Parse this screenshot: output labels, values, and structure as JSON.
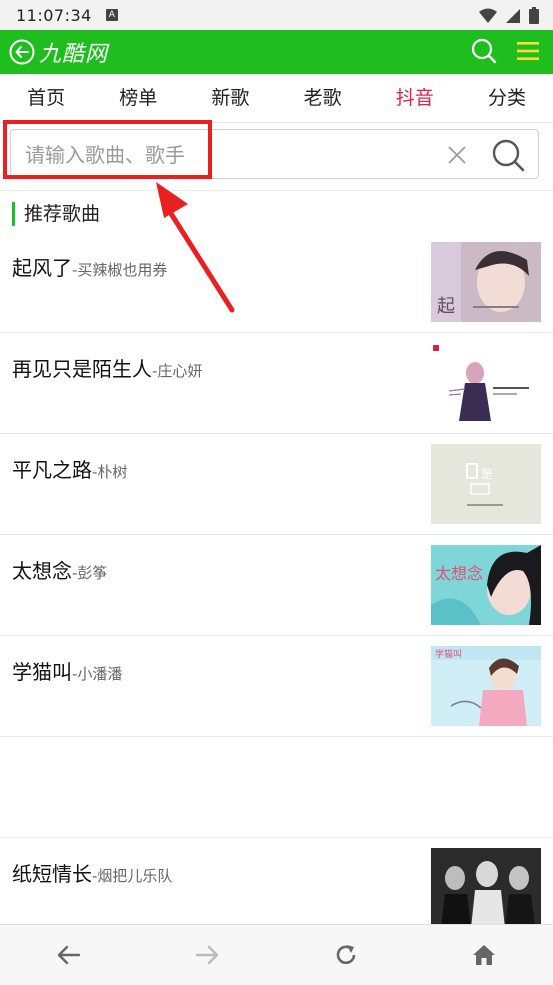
{
  "status_bar": {
    "time": "11:07:34",
    "badge": "A",
    "icons": [
      "wifi-icon",
      "signal-icon",
      "battery-icon"
    ]
  },
  "app_bar": {
    "title": "九酷网",
    "icons": [
      "back-icon",
      "search-icon",
      "menu-icon"
    ],
    "background": "#1fbe1f",
    "menu_color": "#ffdd33"
  },
  "nav": {
    "tabs": [
      {
        "label": "首页"
      },
      {
        "label": "榜单"
      },
      {
        "label": "新歌"
      },
      {
        "label": "老歌"
      },
      {
        "label": "抖音",
        "active": true
      },
      {
        "label": "分类"
      }
    ],
    "active_color": "#e8204a"
  },
  "search": {
    "placeholder": "请输入歌曲、歌手",
    "value": ""
  },
  "section": {
    "title": "推荐歌曲"
  },
  "songs": [
    {
      "title": "起风了",
      "artist": "-买辣椒也用券"
    },
    {
      "title": "再见只是陌生人",
      "artist": "-庄心妍"
    },
    {
      "title": "平凡之路",
      "artist": "-朴树"
    },
    {
      "title": "太想念",
      "artist": "-彭筝"
    },
    {
      "title": "学猫叫",
      "artist": "-小潘潘"
    },
    {
      "title": "纸短情长",
      "artist": "-烟把儿乐队"
    }
  ],
  "covers": {
    "cover1_text": "起",
    "cover3_text": "是",
    "cover4_text": "太想念",
    "cover5_text": "学猫叫"
  },
  "annotation": {
    "color": "#e82020"
  },
  "bottom_nav": {
    "icons": [
      "back-arrow-icon",
      "forward-arrow-icon",
      "refresh-icon",
      "home-icon"
    ]
  }
}
